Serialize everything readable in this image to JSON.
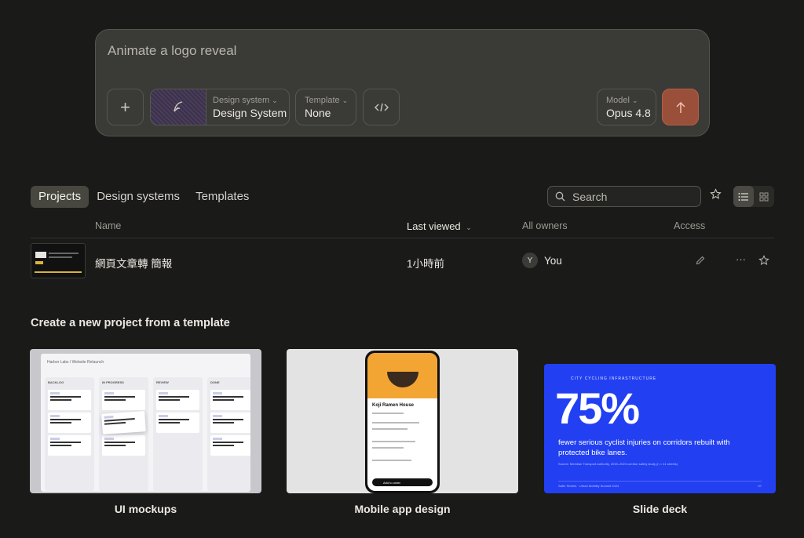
{
  "prompt": {
    "placeholder": "Animate a logo reveal",
    "plus_label": "+",
    "design_system": {
      "label": "Design system",
      "value": "Design System"
    },
    "template": {
      "label": "Template",
      "value": "None"
    },
    "model": {
      "label": "Model",
      "value": "Opus 4.8"
    }
  },
  "tabs": [
    {
      "label": "Projects",
      "active": true
    },
    {
      "label": "Design systems",
      "active": false
    },
    {
      "label": "Templates",
      "active": false
    }
  ],
  "search": {
    "placeholder": "Search"
  },
  "table": {
    "headers": {
      "name": "Name",
      "last_viewed": "Last viewed",
      "owners": "All owners",
      "access": "Access"
    },
    "rows": [
      {
        "name": "網頁文章轉 簡報",
        "last_viewed": "1小時前",
        "owner_initial": "Y",
        "owner": "You"
      }
    ]
  },
  "templates": {
    "title": "Create a new project from a template",
    "items": [
      {
        "label": "UI mockups",
        "preview": {
          "breadcrumb": "Harbor Labs / Website Relaunch",
          "columns": [
            "BACKLOG",
            "IN PROGRESS",
            "REVIEW",
            "DONE"
          ]
        }
      },
      {
        "label": "Mobile app design",
        "preview": {
          "restaurant": "Koji Ramen House",
          "cta": "Add to order"
        }
      },
      {
        "label": "Slide deck",
        "preview": {
          "kicker": "CITY CYCLING INFRASTRUCTURE",
          "stat": "75%",
          "subtitle": "fewer serious cyclist injuries on corridors rebuilt with protected bike lanes.",
          "source": "Source: Meridian Transport Authority, 2019–2023 corridor safety study (n = 41 streets)",
          "footer_left": "Safer Streets · Urban Mobility Summit 2024",
          "footer_right": "07"
        }
      }
    ]
  },
  "colors": {
    "background": "#1a1a19",
    "card": "#3a3a36",
    "send_button": "#9a4f3a",
    "slide_blue": "#2240f2",
    "phone_orange": "#f3a533"
  }
}
